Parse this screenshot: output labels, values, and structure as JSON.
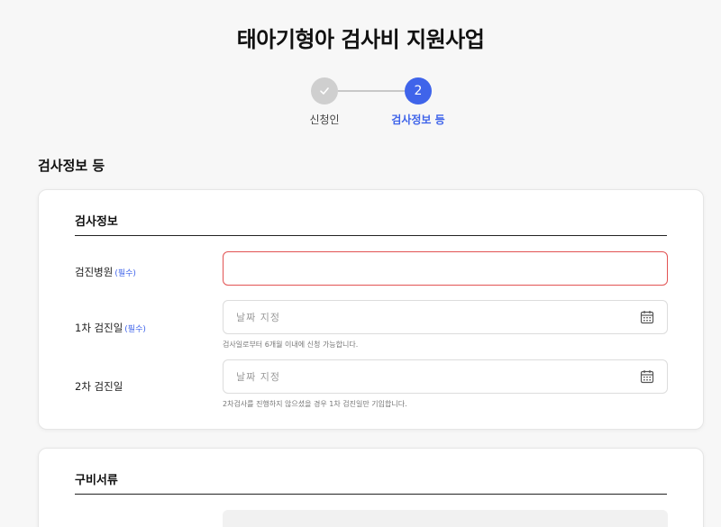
{
  "page": {
    "title": "태아기형아 검사비 지원사업"
  },
  "stepper": {
    "steps": [
      {
        "number": "",
        "label": "신청인",
        "state": "done"
      },
      {
        "number": "2",
        "label": "검사정보 등",
        "state": "active"
      }
    ],
    "colors": {
      "active": "#3f64ea",
      "done": "#cfcfcf"
    }
  },
  "section": {
    "heading": "검사정보 등"
  },
  "exam_info": {
    "title": "검사정보",
    "fields": {
      "hospital": {
        "label": "검진병원",
        "required": "(필수)",
        "value": ""
      },
      "first_date": {
        "label": "1차 검진일",
        "required": "(필수)",
        "placeholder": "날짜 지정",
        "hint": "검사일로부터 6개월 이내에 신청 가능합니다."
      },
      "second_date": {
        "label": "2차 검진일",
        "placeholder": "날짜 지정",
        "hint": "2차검사를 진행하지 않으셨을 경우 1차 검진일만 기입합니다."
      }
    }
  },
  "documents": {
    "title": "구비서류"
  },
  "colors": {
    "accent": "#3f64ea",
    "error": "#e25353"
  }
}
